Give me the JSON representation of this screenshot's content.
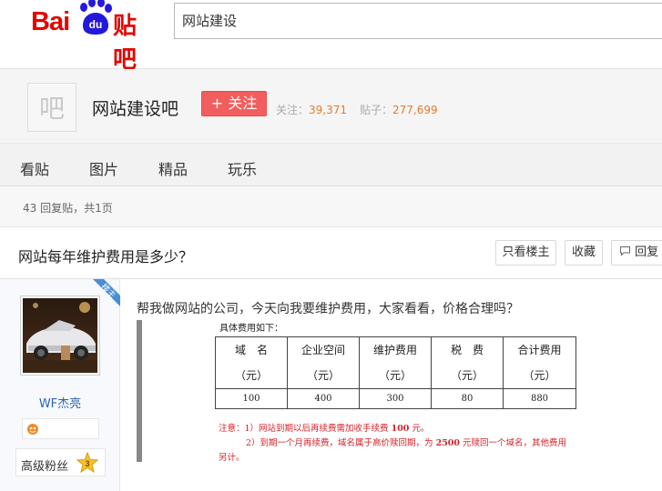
{
  "header": {
    "logo_text": "Bai",
    "logo_du": "du",
    "logo_tieba": "贴吧",
    "search_value": "网站建设"
  },
  "forum": {
    "avatar_char": "吧",
    "name": "网站建设吧",
    "follow_label": "+ 关注",
    "follow_count_label": "关注：",
    "follow_count": "39,371",
    "post_count_label": "贴子：",
    "post_count": "277,699"
  },
  "nav": {
    "items": [
      "看贴",
      "图片",
      "精品",
      "玩乐"
    ]
  },
  "thread": {
    "reply_info": "43 回复贴，共1页",
    "title": "网站每年维护费用是多少？",
    "buttons": {
      "only_op": "只看楼主",
      "favorite": "收藏",
      "reply": "回复"
    }
  },
  "post": {
    "op_ribbon": "楼主",
    "username": "WF杰亮",
    "fan_level_label": "高级粉丝",
    "fan_level": "3",
    "content": "帮我做网站的公司，今天向我要维护费用，大家看看，价格合理吗？",
    "image": {
      "caption": "具体费用如下：",
      "headers": [
        [
          "域　名",
          "（元）"
        ],
        [
          "企业空间",
          "（元）"
        ],
        [
          "维护费用",
          "（元）"
        ],
        [
          "税　费",
          "（元）"
        ],
        [
          "合计费用",
          "（元）"
        ]
      ],
      "values": [
        "100",
        "400",
        "300",
        "80",
        "880"
      ],
      "note_line1_prefix": "注意：1）网站到期以后再续费需加收手续费 ",
      "note_line1_amount": "100",
      "note_line1_suffix": " 元。",
      "note_line2_prefix": "2）到期一个月再续费，域名属于高价赎回期，为 ",
      "note_line2_amount": "2500",
      "note_line2_suffix": " 元赎回一个域名，其他费用",
      "note_line3": "另计。"
    }
  },
  "colors": {
    "brand_red": "#e10601",
    "follow_button": "#f25d5d",
    "stat_number": "#e77a2b",
    "username_link": "#2d64b3",
    "op_ribbon": "#4a8ed8",
    "note_red": "#d7232b"
  },
  "icons": {
    "logo_paw": "paw-icon",
    "reply": "speech-bubble-icon",
    "badge": "game-icon",
    "level": "star-level-icon"
  }
}
